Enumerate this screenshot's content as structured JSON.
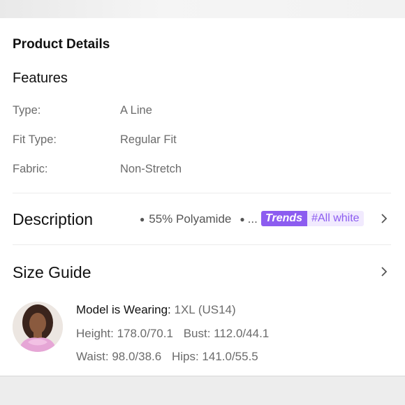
{
  "product_details": {
    "title": "Product Details",
    "features_title": "Features",
    "specs": [
      {
        "label": "Type:",
        "value": "A Line"
      },
      {
        "label": "Fit Type:",
        "value": "Regular Fit"
      },
      {
        "label": "Fabric:",
        "value": "Non-Stretch"
      }
    ]
  },
  "description": {
    "title": "Description",
    "snippet": "55% Polyamide",
    "ellipsis": "...",
    "trends_badge": "Trends",
    "trends_tag": "#All white"
  },
  "size_guide": {
    "title": "Size Guide",
    "model_label": "Model is Wearing:",
    "model_size": "1XL (US14)",
    "height": "Height: 178.0/70.1",
    "bust": "Bust: 112.0/44.1",
    "waist": "Waist: 98.0/38.6",
    "hips": "Hips: 141.0/55.5"
  },
  "colors": {
    "trends_purple": "#8c5cf0",
    "trends_tag_bg": "#f1eafe",
    "muted_text": "#6b6b6b"
  },
  "icons": {
    "description_chevron": "chevron-right-icon",
    "size_guide_chevron": "chevron-right-icon"
  }
}
